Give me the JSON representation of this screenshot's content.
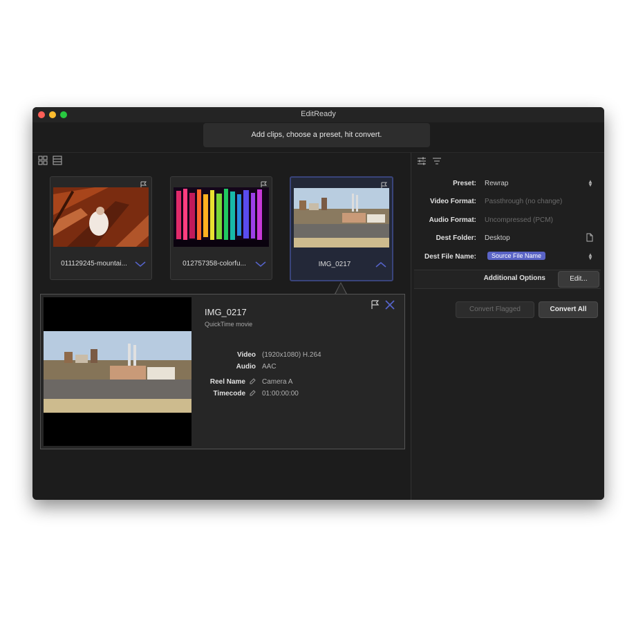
{
  "window": {
    "title": "EditReady",
    "traffic_lights": {
      "close": "#ff5f57",
      "minimize": "#febc2e",
      "zoom": "#28c840"
    }
  },
  "hint": "Add clips, choose a preset, hit convert.",
  "view_toggle": {
    "grid_icon": "grid-view-icon",
    "list_icon": "list-view-icon"
  },
  "right_tabs": {
    "settings_icon": "sliders-icon",
    "sort_icon": "filter-lines-icon"
  },
  "clips": [
    {
      "name": "011129245-mountai...",
      "selected": false,
      "expanded": false
    },
    {
      "name": "012757358-colorfu...",
      "selected": false,
      "expanded": false
    },
    {
      "name": "IMG_0217",
      "selected": true,
      "expanded": true
    }
  ],
  "detail": {
    "title": "IMG_0217",
    "subtitle": "QuickTime movie",
    "video_label": "Video",
    "video_value": "(1920x1080) H.264",
    "audio_label": "Audio",
    "audio_value": "AAC",
    "reel_label": "Reel Name",
    "reel_value": "Camera A",
    "timecode_label": "Timecode",
    "timecode_value": "01:00:00:00"
  },
  "settings": {
    "preset_label": "Preset:",
    "preset_value": "Rewrap",
    "video_format_label": "Video Format:",
    "video_format_value": "Passthrough (no change)",
    "audio_format_label": "Audio Format:",
    "audio_format_value": "Uncompressed (PCM)",
    "dest_folder_label": "Dest Folder:",
    "dest_folder_value": "Desktop",
    "dest_file_label": "Dest File Name:",
    "dest_file_token": "Source File Name",
    "additional_label": "Additional Options",
    "edit_label": "Edit..."
  },
  "buttons": {
    "convert_flagged": "Convert Flagged",
    "convert_all": "Convert All"
  },
  "colors": {
    "accent": "#5a64c6",
    "selection_border": "#39447a",
    "window_bg": "#1c1c1c"
  }
}
